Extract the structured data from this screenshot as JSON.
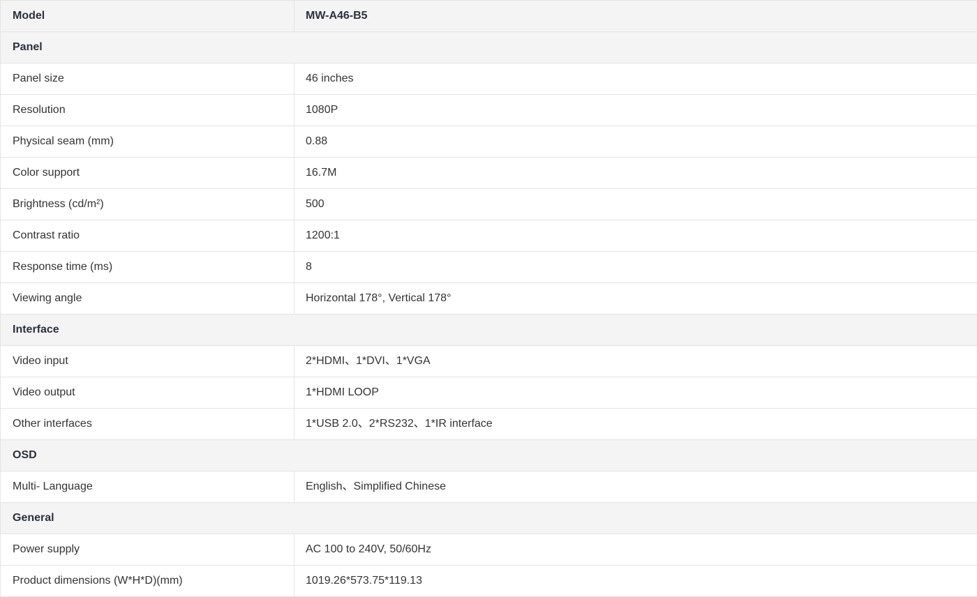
{
  "header": {
    "label": "Model",
    "value": "MW-A46-B5"
  },
  "sections": [
    {
      "title": "Panel",
      "rows": [
        {
          "label": "Panel size",
          "value": "46 inches"
        },
        {
          "label": "Resolution",
          "value": "1080P"
        },
        {
          "label": "Physical seam (mm)",
          "value": "0.88"
        },
        {
          "label": "Color support",
          "value": "16.7M"
        },
        {
          "label": "Brightness (cd/m²)",
          "value": "500"
        },
        {
          "label": "Contrast ratio",
          "value": "1200:1"
        },
        {
          "label": "Response time (ms)",
          "value": "8"
        },
        {
          "label": "Viewing angle",
          "value": "Horizontal 178°, Vertical 178°"
        }
      ]
    },
    {
      "title": "Interface",
      "rows": [
        {
          "label": "Video input",
          "value": "2*HDMI、1*DVI、1*VGA"
        },
        {
          "label": "Video output",
          "value": "1*HDMI LOOP"
        },
        {
          "label": "Other interfaces",
          "value": "1*USB 2.0、2*RS232、1*IR interface"
        }
      ]
    },
    {
      "title": "OSD",
      "rows": [
        {
          "label": "Multi- Language",
          "value": "English、Simplified Chinese"
        }
      ]
    },
    {
      "title": "General",
      "rows": [
        {
          "label": "Power supply",
          "value": "AC 100 to 240V, 50/60Hz"
        },
        {
          "label": "Product dimensions (W*H*D)(mm)",
          "value": "1019.26*573.75*119.13"
        }
      ]
    }
  ]
}
